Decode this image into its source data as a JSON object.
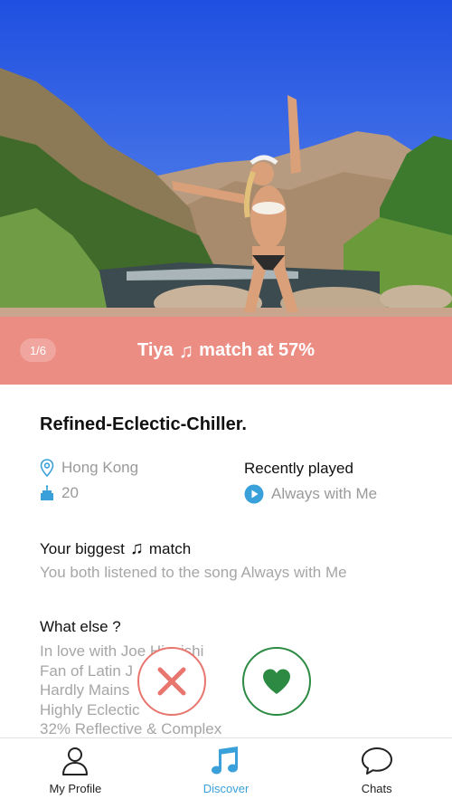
{
  "photo": {
    "counter": "1/6"
  },
  "match_bar": {
    "name": "Tiya",
    "note_icon": "music-note-icon",
    "text": "match at 57%"
  },
  "profile": {
    "handle": "Refined-Eclectic-Chiller.",
    "location": "Hong Kong",
    "age": "20",
    "recently_played_title": "Recently played",
    "recently_played_song": "Always with Me"
  },
  "biggest_match": {
    "title_prefix": "Your biggest",
    "title_suffix": "match",
    "text": "You both listened to the song Always with Me"
  },
  "what_else": {
    "title": "What else ?",
    "items": [
      "In love with Joe Hisaishi",
      "Fan of Latin J",
      "Hardly Mains",
      "Highly Eclectic",
      "32% Reflective & Complex"
    ]
  },
  "actions": {
    "nope_icon": "x-icon",
    "like_icon": "heart-icon",
    "nope_color": "#e8766f",
    "like_color": "#2d8a43"
  },
  "tabs": [
    {
      "label": "My Profile",
      "icon": "user-icon"
    },
    {
      "label": "Discover",
      "icon": "music-note-icon"
    },
    {
      "label": "Chats",
      "icon": "chat-bubble-icon"
    }
  ],
  "colors": {
    "accent": "#3aa0d9",
    "match_bar": "#f08a82"
  }
}
